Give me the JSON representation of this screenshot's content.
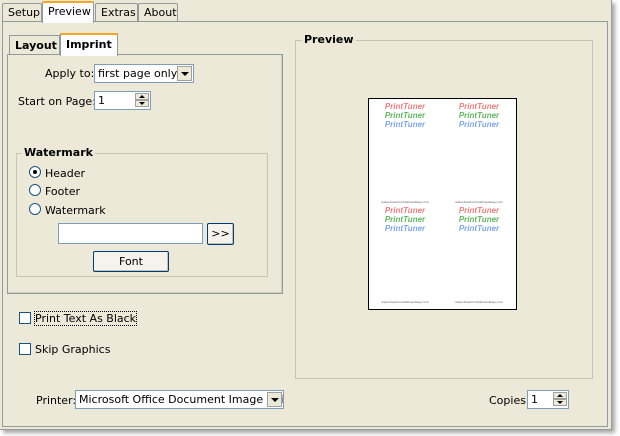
{
  "tabs": {
    "setup": "Setup",
    "preview": "Preview",
    "extras": "Extras",
    "about": "About"
  },
  "inner_tabs": {
    "layout": "Layout",
    "imprint": "Imprint"
  },
  "imprint": {
    "apply_to_label": "Apply to:",
    "apply_to_value": "first page only",
    "start_page_label": "Start on Page:",
    "start_page_value": "1"
  },
  "watermark": {
    "title": "Watermark",
    "options": [
      "Header",
      "Footer",
      "Watermark"
    ],
    "selected": "Header",
    "text_value": "",
    "more_button": ">>",
    "font_button": "Font"
  },
  "options": {
    "print_text_black": "Print Text As Black",
    "skip_graphics": "Skip Graphics"
  },
  "preview": {
    "title": "Preview",
    "watermark_lines": [
      "PrintTuner",
      "PrintTuner",
      "PrintTuner"
    ],
    "url_text": "www.dreamindustriesdewy.com",
    "colors": [
      "#e47f7f",
      "#63b463",
      "#7fa7e4"
    ]
  },
  "footer": {
    "printer_label": "Printer:",
    "printer_value": "Microsoft Office Document Image Writer",
    "copies_label": "Copies:",
    "copies_value": "1"
  }
}
